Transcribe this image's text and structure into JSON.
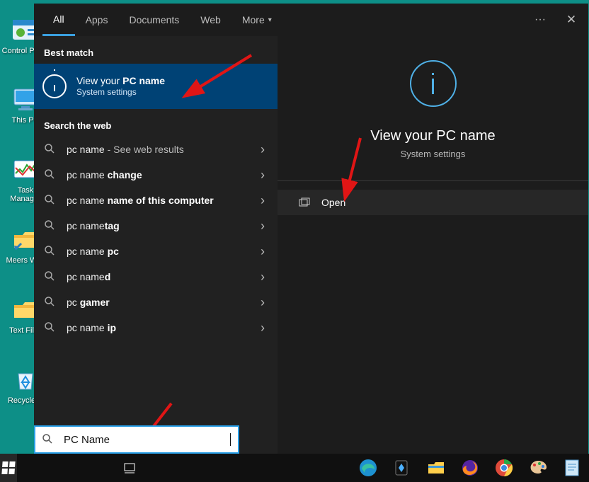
{
  "desktop": {
    "icons": [
      {
        "label": "Control Panel"
      },
      {
        "label": "This PC"
      },
      {
        "label": "Task Manager"
      },
      {
        "label": "Meers W…"
      },
      {
        "label": "Text Fil…"
      },
      {
        "label": "Recycle…"
      }
    ]
  },
  "tabs": {
    "all": "All",
    "apps": "Apps",
    "documents": "Documents",
    "web": "Web",
    "more": "More"
  },
  "sections": {
    "best": "Best match",
    "web": "Search the web"
  },
  "best_match": {
    "title_pre": "View your ",
    "title_bold": "PC name",
    "subtitle": "System settings"
  },
  "web_items": [
    {
      "pre": "pc name",
      "bold": "",
      "suffix": " - See web results"
    },
    {
      "pre": "pc name ",
      "bold": "change",
      "suffix": ""
    },
    {
      "pre": "pc name ",
      "bold": "name of this computer",
      "suffix": ""
    },
    {
      "pre": "pc name",
      "bold": "tag",
      "suffix": ""
    },
    {
      "pre": "pc name ",
      "bold": "pc",
      "suffix": ""
    },
    {
      "pre": "pc name",
      "bold": "d",
      "suffix": ""
    },
    {
      "pre": "pc ",
      "bold": "gamer",
      "suffix": ""
    },
    {
      "pre": "pc name ",
      "bold": "ip",
      "suffix": ""
    }
  ],
  "preview": {
    "title": "View your PC name",
    "subtitle": "System settings",
    "open": "Open"
  },
  "search": {
    "value": "PC Name"
  }
}
